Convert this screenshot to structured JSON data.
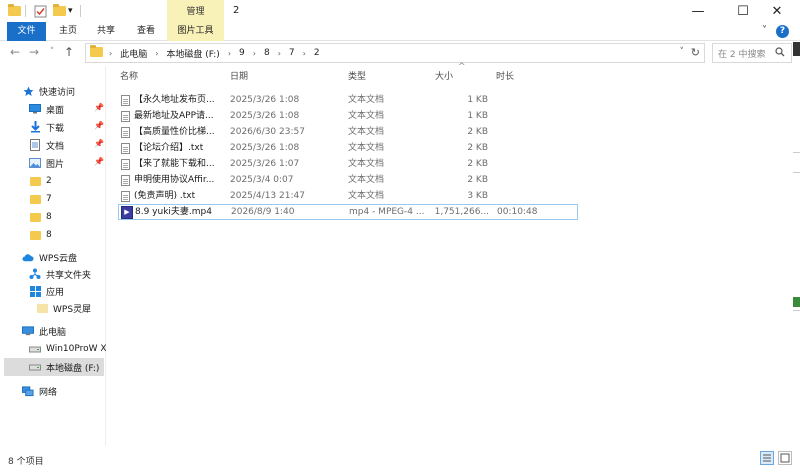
{
  "window": {
    "title": "2",
    "manage_tab": "管理",
    "controls": {
      "minimize": "—",
      "maximize": "☐",
      "close": "✕"
    }
  },
  "ribbon": {
    "tabs": [
      "文件",
      "主页",
      "共享",
      "查看",
      "图片工具"
    ],
    "file_color": "#1a6fc9",
    "tools_color": "#f9f2b8",
    "expand_glyph": "˅",
    "help_glyph": "?"
  },
  "navigation": {
    "back": "←",
    "forward": "→",
    "recent": "˅",
    "up": "↑",
    "breadcrumbs": [
      "此电脑",
      "本地磁盘 (F:)",
      "9",
      "8",
      "7",
      "2"
    ],
    "breadcrumb_sep": "›",
    "refresh": "↻",
    "dropdown": "˅",
    "search_placeholder": "在 2 中搜索"
  },
  "sidebar": {
    "quick_access": "快速访问",
    "pinned": [
      {
        "label": "桌面",
        "icon": "desktop-icon"
      },
      {
        "label": "下载",
        "icon": "download-icon"
      },
      {
        "label": "文档",
        "icon": "document-icon"
      },
      {
        "label": "图片",
        "icon": "picture-icon"
      }
    ],
    "folders": [
      "2",
      "7",
      "8",
      "8"
    ],
    "wps_cloud": "WPS云盘",
    "shared_folder": "共享文件夹",
    "apps": "应用",
    "wps_lingxi": "WPS灵犀",
    "this_pc": "此电脑",
    "drive_c": "Win10ProW X",
    "drive_f": "本地磁盘 (F:)",
    "network": "网络",
    "pin_glyph": "📌"
  },
  "columns": {
    "name": "名称",
    "date": "日期",
    "type": "类型",
    "size": "大小",
    "duration": "时长",
    "sort_glyph": "^"
  },
  "files": [
    {
      "name": "【永久地址发布页...",
      "date": "2025/3/26 1:08",
      "type": "文本文档",
      "size": "1 KB",
      "duration": "",
      "kind": "txt"
    },
    {
      "name": "最新地址及APP请...",
      "date": "2025/3/26 1:08",
      "type": "文本文档",
      "size": "1 KB",
      "duration": "",
      "kind": "txt"
    },
    {
      "name": "【高质量性价比梯...",
      "date": "2026/6/30 23:57",
      "type": "文本文档",
      "size": "2 KB",
      "duration": "",
      "kind": "txt"
    },
    {
      "name": "【论坛介绍】.txt",
      "date": "2025/3/26 1:08",
      "type": "文本文档",
      "size": "2 KB",
      "duration": "",
      "kind": "txt"
    },
    {
      "name": "【来了就能下载和...",
      "date": "2025/3/26 1:07",
      "type": "文本文档",
      "size": "2 KB",
      "duration": "",
      "kind": "txt"
    },
    {
      "name": "申明使用协议Affir...",
      "date": "2025/3/4 0:07",
      "type": "文本文档",
      "size": "2 KB",
      "duration": "",
      "kind": "txt"
    },
    {
      "name": "(免责声明) .txt",
      "date": "2025/4/13 21:47",
      "type": "文本文档",
      "size": "3 KB",
      "duration": "",
      "kind": "txt"
    },
    {
      "name": "8.9 yuki夫妻.mp4",
      "date": "2026/8/9 1:40",
      "type": "mp4 - MPEG-4 ...",
      "size": "1,751,266...",
      "duration": "00:10:48",
      "kind": "mp4"
    }
  ],
  "status": {
    "item_count": "8 个项目"
  }
}
